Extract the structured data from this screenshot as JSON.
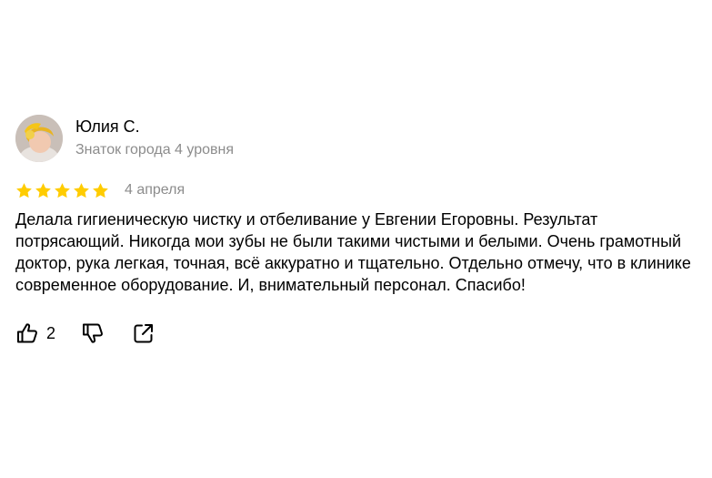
{
  "review": {
    "author": {
      "name": "Юлия С.",
      "level": "Знаток города 4 уровня",
      "avatar_icon": "user-avatar"
    },
    "rating": {
      "stars": 5,
      "max": 5,
      "color": "#fc3f1d"
    },
    "date": "4 апреля",
    "text": "Делала гигиеническую чистку и отбеливание у Евгении Егоровны. Результат потрясающий. Никогда мои зубы не были такими чистыми и белыми. Очень грамотный доктор, рука легкая, точная, всё аккуратно и тщательно. Отдельно отмечу, что в клинике современное оборудование. И, внимательный персонал. Спасибо!",
    "actions": {
      "like_count": "2",
      "like_icon": "thumbs-up-icon",
      "dislike_icon": "thumbs-down-icon",
      "share_icon": "share-icon"
    }
  },
  "colors": {
    "star": "#ffcc00",
    "muted_text": "#8c8c8c"
  }
}
